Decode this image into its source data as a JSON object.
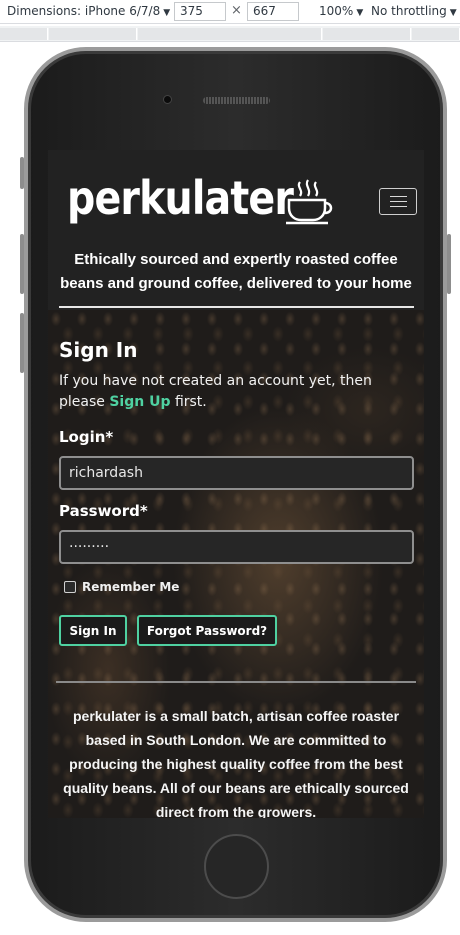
{
  "devtools": {
    "device": "Dimensions: iPhone 6/7/8",
    "width": "375",
    "times": "×",
    "height": "667",
    "zoom": "100%",
    "throttling": "No throttling"
  },
  "site": {
    "logo": "perkulater",
    "tagline": "Ethically sourced and expertly roasted coffee beans and ground coffee, delivered to your home"
  },
  "signin": {
    "title": "Sign In",
    "message_before": "If you have not created an account yet, then please",
    "signup_link": "Sign Up",
    "message_after": "first.",
    "login_label": "Login*",
    "login_value": "richardash",
    "password_label": "Password*",
    "password_value": "·········",
    "remember_label": "Remember Me",
    "signin_button": "Sign In",
    "forgot_button": "Forgot Password?"
  },
  "about": {
    "text": "perkulater is a small batch, artisan coffee roaster based in South London. We are committed to producing the highest quality coffee from the best quality beans. All of our beans are ethically sourced direct from the growers."
  },
  "colors": {
    "accent": "#4fd1a1",
    "header_bg": "#222222"
  }
}
